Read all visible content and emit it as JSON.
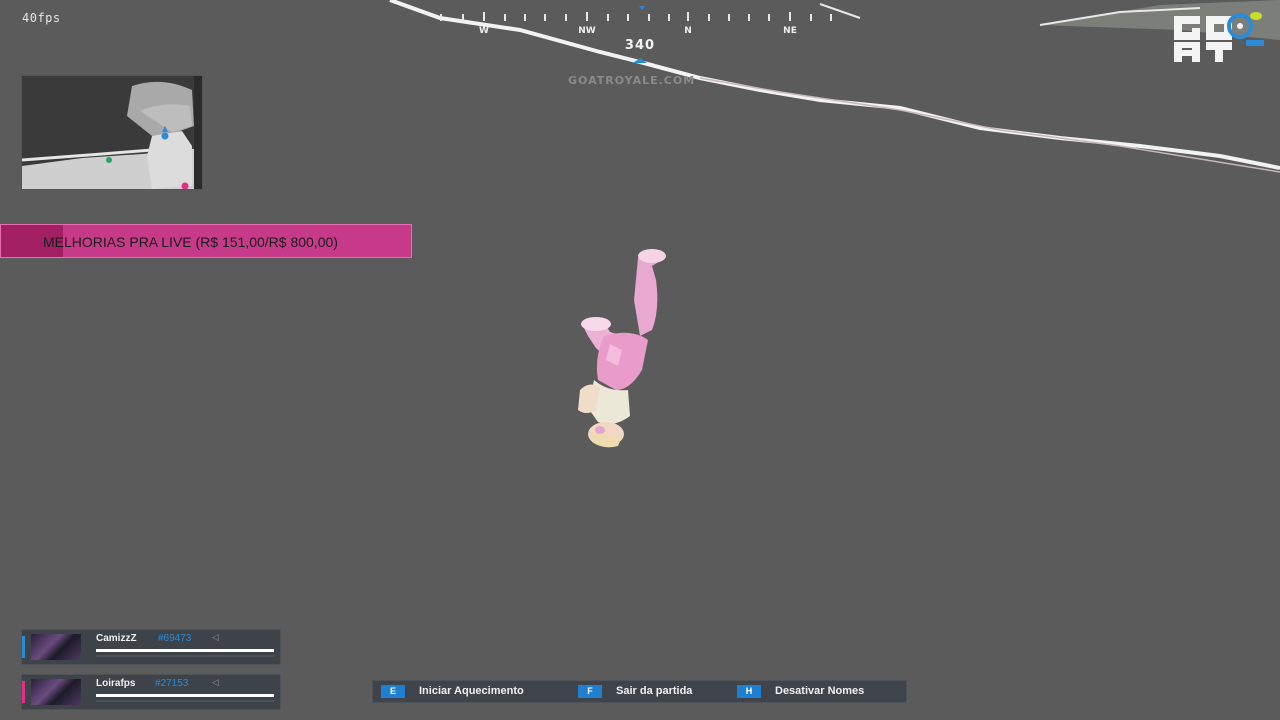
{
  "hud": {
    "fps": "40fps",
    "heading": "340",
    "website": "GOATROYALE.COM"
  },
  "compass": {
    "directions": [
      "W",
      "NW",
      "N",
      "NE"
    ]
  },
  "donation_goal": {
    "text": "MELHORIAS PRA LIVE (R$ 151,00/R$ 800,00)",
    "progress": 0.19,
    "color": "#c73a8a"
  },
  "team": [
    {
      "name": "CamizzZ",
      "tag": "#69473",
      "stripe_color": "#2a8cd8",
      "health": 1.0
    },
    {
      "name": "Loirafps",
      "tag": "#27153",
      "stripe_color": "#e0308a",
      "health": 1.0
    }
  ],
  "actions": [
    {
      "key": "E",
      "label": "Iniciar Aquecimento"
    },
    {
      "key": "F",
      "label": "Sair da partida"
    },
    {
      "key": "H",
      "label": "Desativar Nomes"
    }
  ],
  "icons": {
    "minimap": "minimap",
    "speaker": "speaker-icon",
    "logo": "goat-royale-logo"
  }
}
